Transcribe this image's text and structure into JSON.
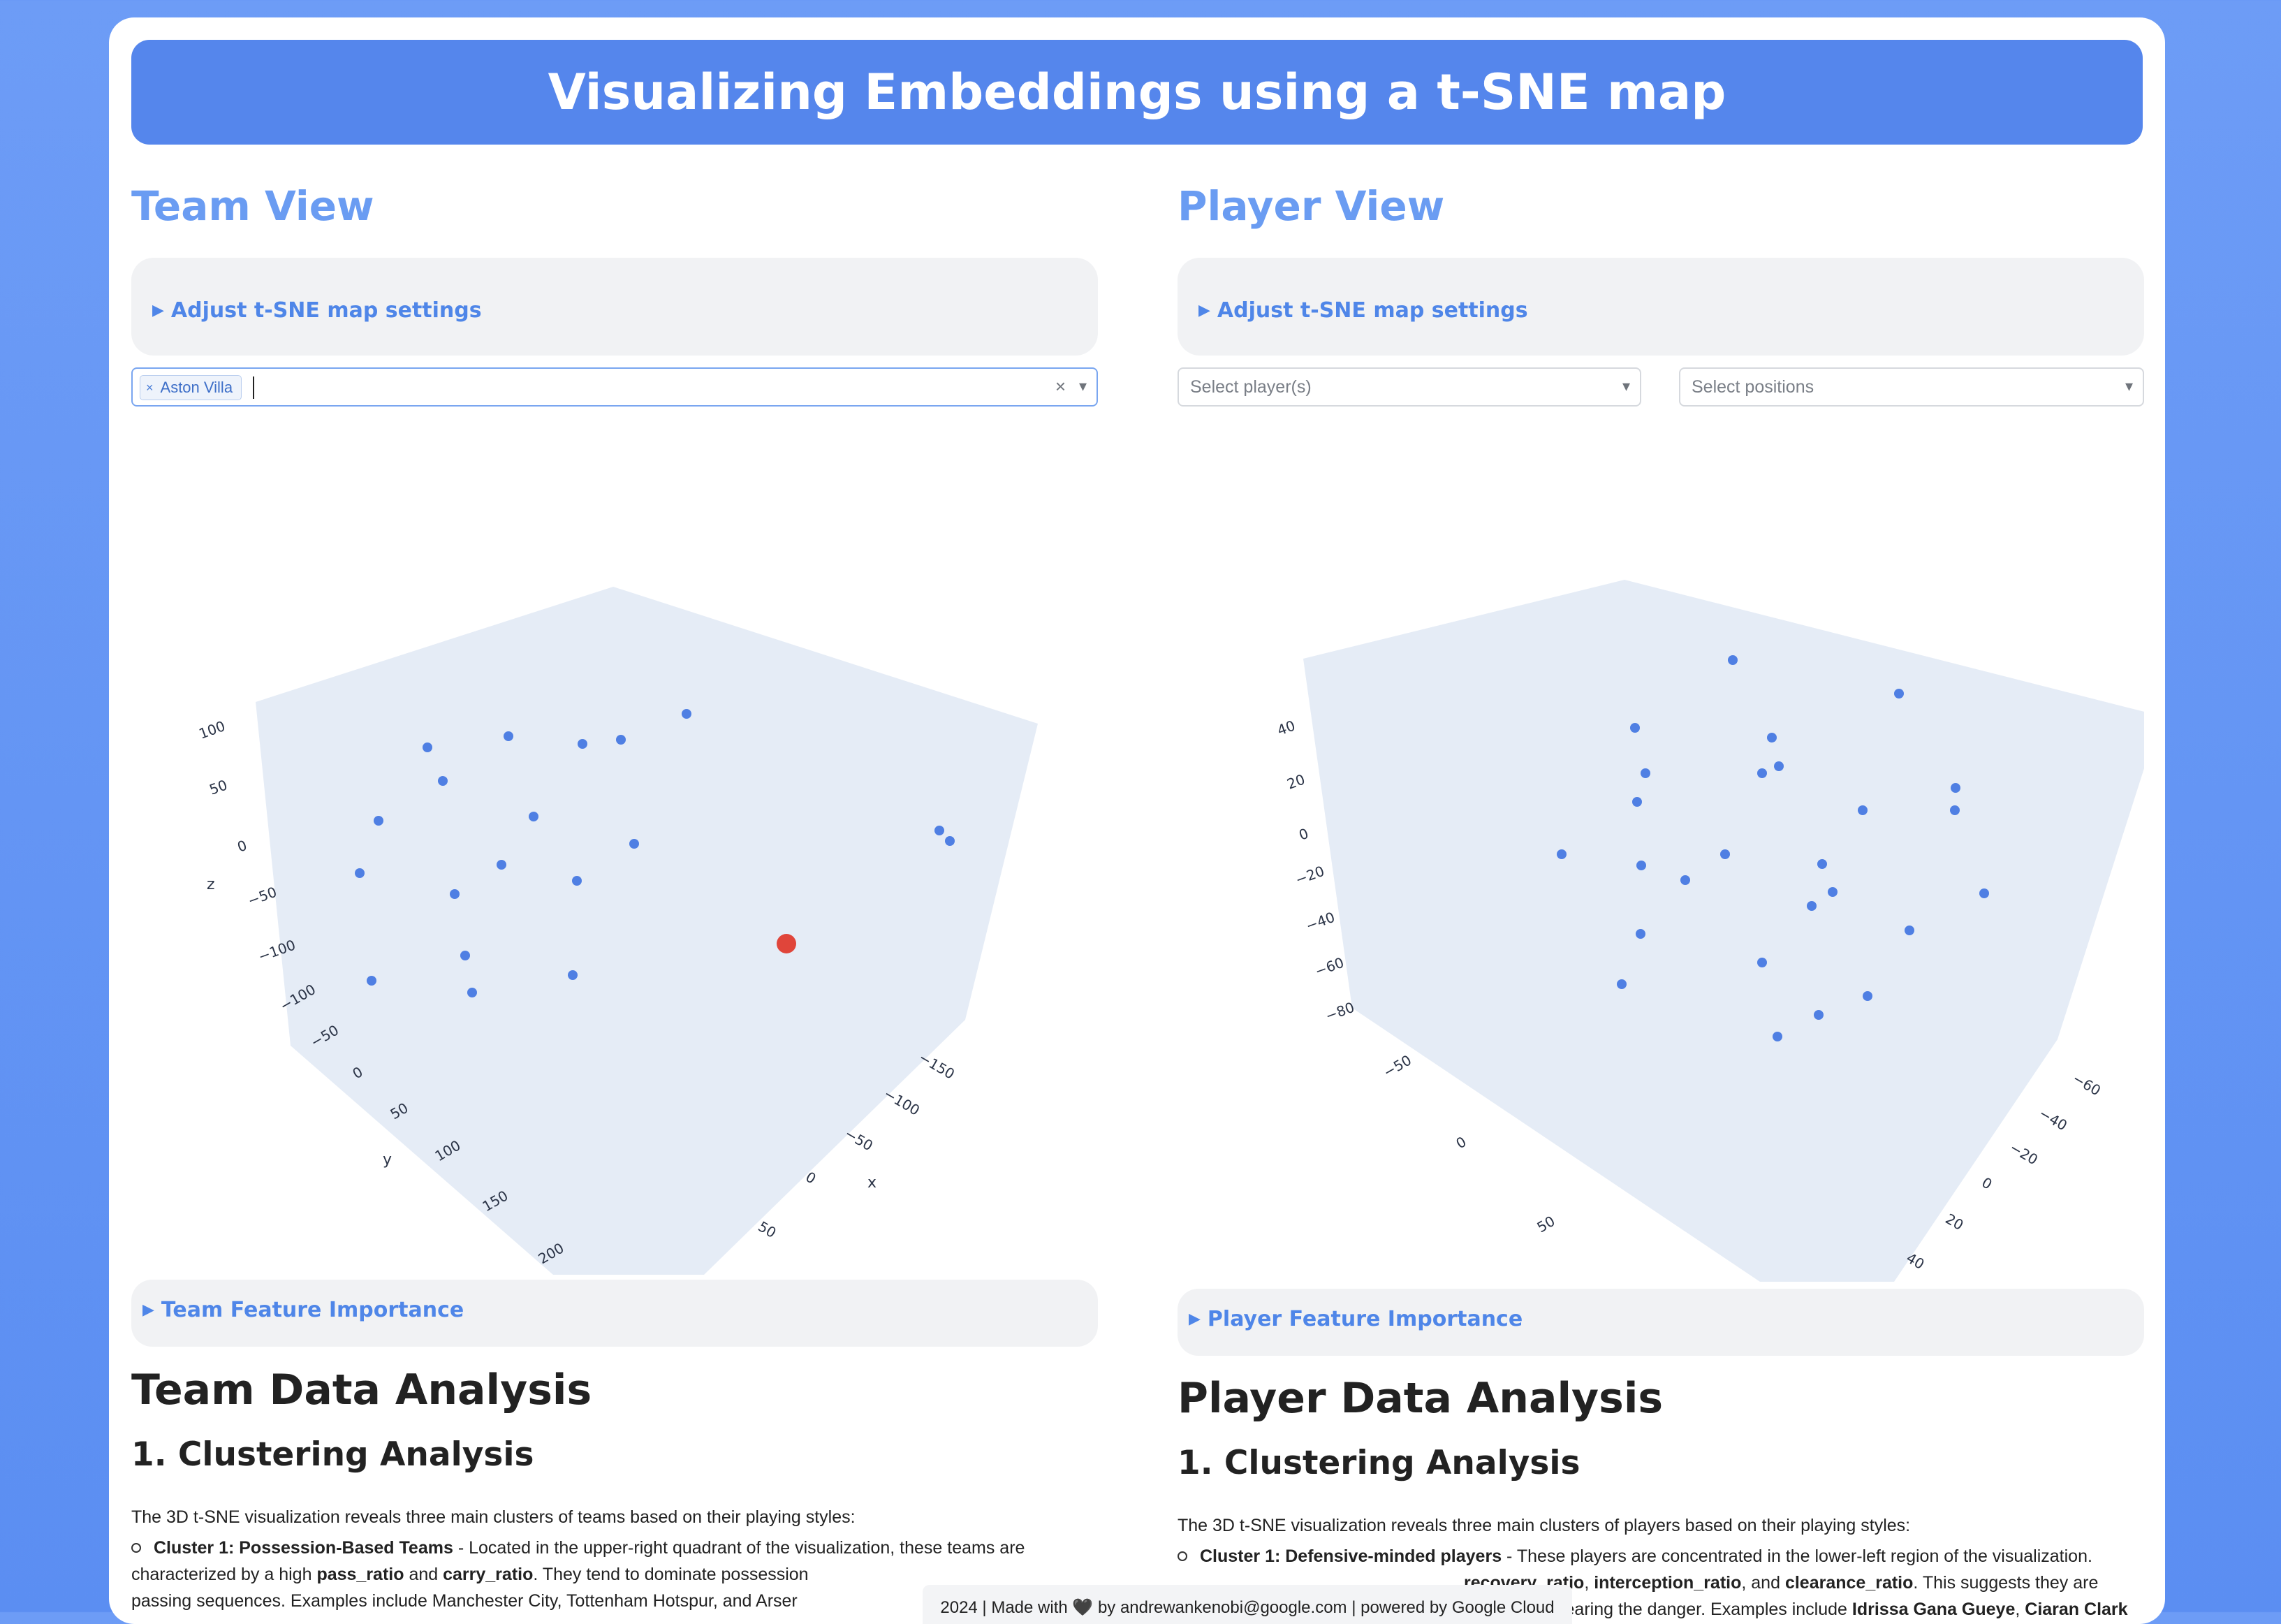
{
  "banner": {
    "title": "Visualizing Embeddings using a t-SNE map"
  },
  "team": {
    "view_title": "Team View",
    "settings_summary": "Adjust t-SNE map settings",
    "select": {
      "tag": "Aston Villa",
      "tag_remove": "×",
      "clear": "×",
      "caret": "▾"
    },
    "feature_summary": "Team Feature Importance",
    "analysis_title": "Team Data Analysis",
    "section_title": "1. Clustering Analysis",
    "intro": "The 3D t-SNE visualization reveals three main clusters of teams based on their playing styles:",
    "bullet": {
      "label": "Cluster 1: Possession-Based Teams",
      "text1": " - Located in the upper-right quadrant of the visualization, these teams are characterized by a high ",
      "b1": "pass_ratio",
      "text2": " and ",
      "b2": "carry_ratio",
      "text3": ". They tend to dominate possession",
      "line3": "passing sequences. Examples include Manchester City, Tottenham Hotspur, and Arser"
    },
    "ticks": {
      "z": [
        "100",
        "50",
        "0",
        "−50",
        "−100"
      ],
      "y": [
        "−100",
        "−50",
        "0",
        "50",
        "100",
        "150",
        "200"
      ],
      "x": [
        "−150",
        "−100",
        "−50",
        "0",
        "50"
      ]
    },
    "axis_labels": {
      "x": "x",
      "y": "y",
      "z": "z"
    }
  },
  "player": {
    "view_title": "Player View",
    "settings_summary": "Adjust t-SNE map settings",
    "players_placeholder": "Select player(s)",
    "positions_placeholder": "Select positions",
    "caret": "▾",
    "feature_summary": "Player Feature Importance",
    "analysis_title": "Player Data Analysis",
    "section_title": "1. Clustering Analysis",
    "intro": "The 3D t-SNE visualization reveals three main clusters of players based on their playing styles:",
    "bullet": {
      "label": "Cluster 1: Defensive-minded players",
      "text1": " - These players are concentrated in the lower-left region of the visualization.",
      "b1": "recovery_ratio",
      "b2": "interception_ratio",
      "b3": "clearance_ratio",
      "line2_end": ". This suggests they are",
      "line3_start": "ll back and clearing the danger. Examples include ",
      "b4": "Idrissa Gana Gueye",
      "b5": "Ciaran Clark"
    },
    "ticks": {
      "z": [
        "40",
        "20",
        "0",
        "−20",
        "−40",
        "−60",
        "−80"
      ],
      "y": [
        "−50",
        "0",
        "50"
      ],
      "x": [
        "−60",
        "−40",
        "−20",
        "0",
        "20",
        "40"
      ]
    }
  },
  "footer": {
    "text": "2024 | Made with 🖤 by andrewankenobi@google.com | powered by Google Cloud"
  },
  "colors": {
    "point": "#4f7fe3",
    "highlight": "#e0453a",
    "plane": "#e5ecf6",
    "accent": "#5586ec"
  }
}
